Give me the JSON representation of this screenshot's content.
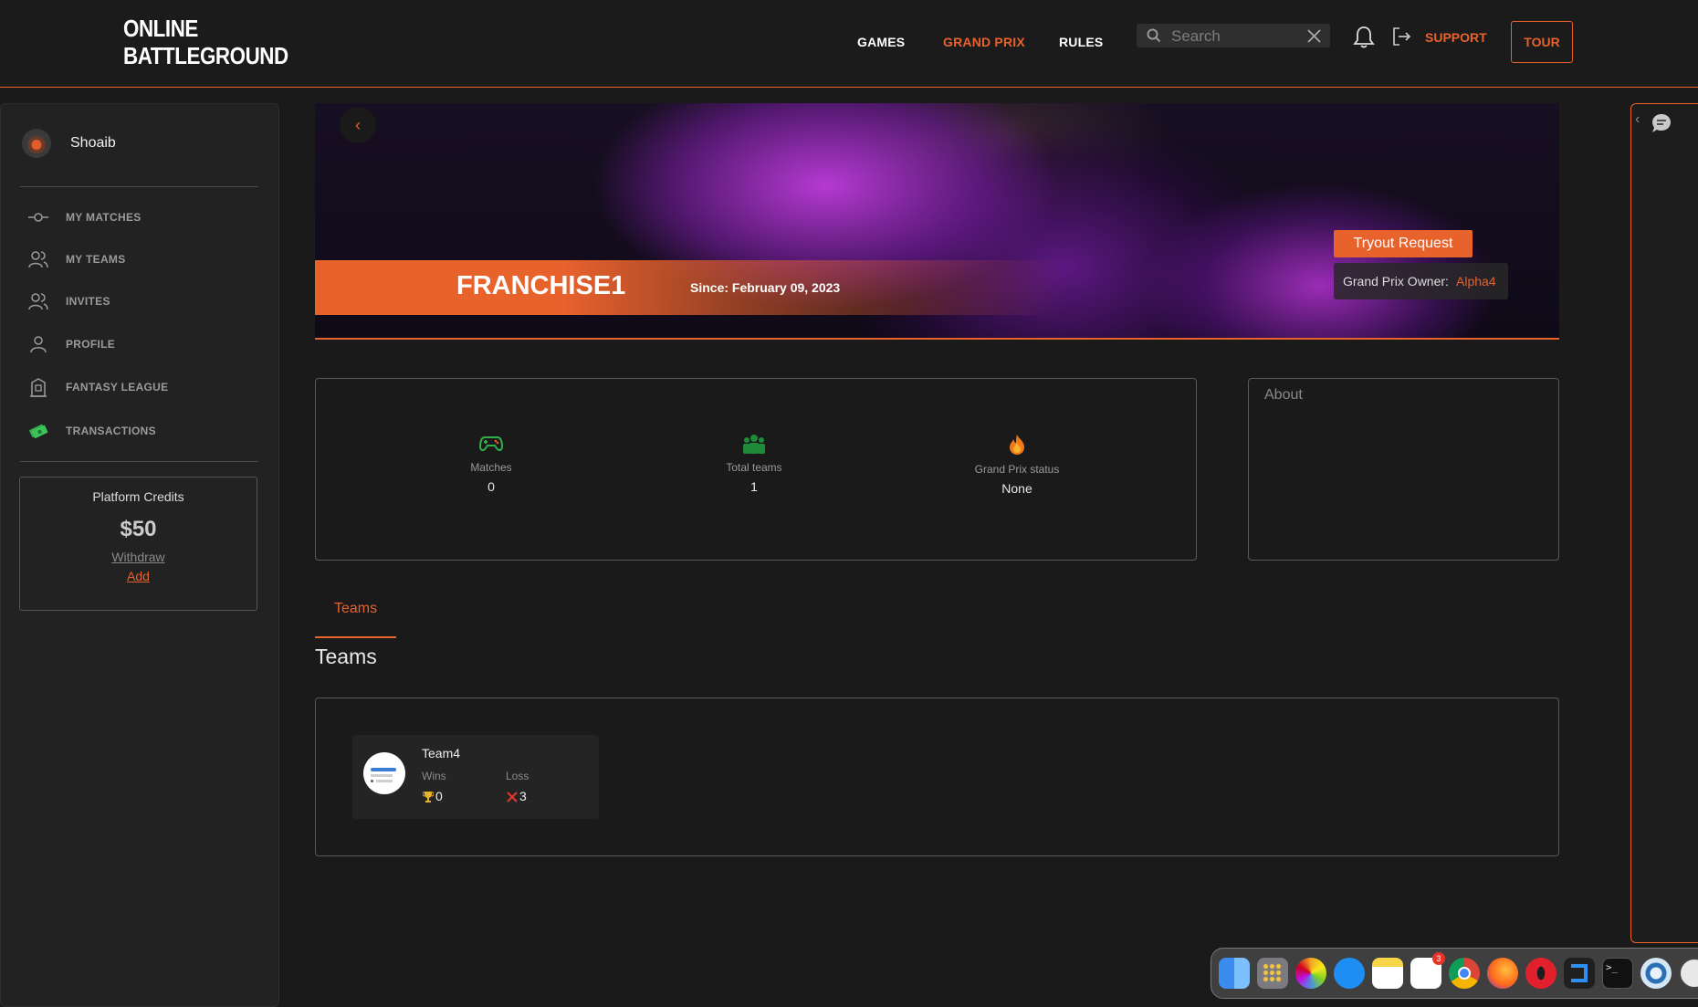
{
  "header": {
    "logo_line1": "ONLINE",
    "logo_line2": "BATTLEGROUND",
    "nav": [
      "GAMES",
      "GRAND PRIX",
      "RULES"
    ],
    "search_placeholder": "Search",
    "support_label": "SUPPORT",
    "tour_label": "TOUR"
  },
  "sidebar": {
    "username": "Shoaib",
    "items": [
      {
        "label": "MY MATCHES",
        "icon": "matches-icon"
      },
      {
        "label": "MY TEAMS",
        "icon": "teams-icon"
      },
      {
        "label": "INVITES",
        "icon": "invites-icon"
      },
      {
        "label": "PROFILE",
        "icon": "profile-icon"
      },
      {
        "label": "FANTASY LEAGUE",
        "icon": "fantasy-league-icon"
      },
      {
        "label": "TRANSACTIONS",
        "icon": "money-icon"
      }
    ],
    "credits": {
      "title": "Platform Credits",
      "amount": "$50",
      "withdraw": "Withdraw",
      "add": "Add"
    }
  },
  "banner": {
    "team_name": "FRANCHISE1",
    "since": "Since: February 09, 2023",
    "tryout_label": "Tryout Request",
    "owner_label": "Grand Prix Owner:",
    "owner_name": "Alpha4"
  },
  "stats": [
    {
      "label": "Matches",
      "value": "0",
      "icon": "gamepad-icon"
    },
    {
      "label": "Total teams",
      "value": "1",
      "icon": "group-icon"
    },
    {
      "label": "Grand Prix status",
      "value": "None",
      "icon": "fire-icon"
    }
  ],
  "about": {
    "title": "About"
  },
  "teams_section": {
    "tab_label": "Teams",
    "heading": "Teams",
    "cards": [
      {
        "name": "Team4",
        "wins_label": "Wins",
        "wins": "0",
        "loss_label": "Loss",
        "loss": "3"
      }
    ]
  },
  "dock": {
    "badges": [
      "3"
    ]
  },
  "colors": {
    "accent": "#e8622c",
    "background": "#1a1a1a",
    "panel": "#222222",
    "green": "#2fae4a"
  }
}
